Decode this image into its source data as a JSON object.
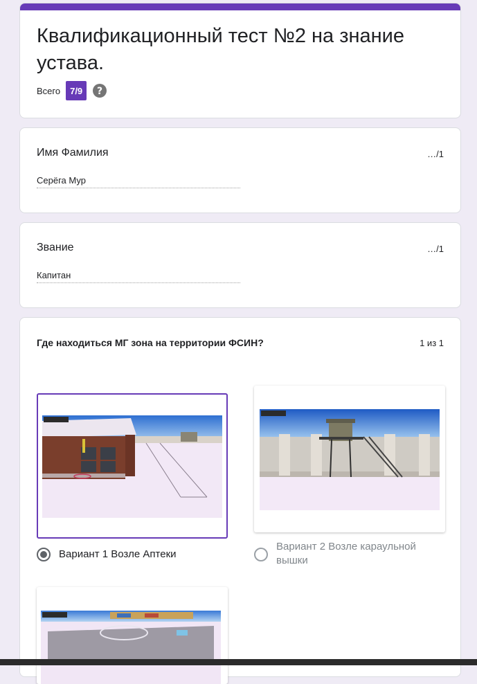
{
  "form": {
    "title": "Квалификационный тест №2 на знание устава.",
    "total_label": "Всего",
    "total_score": "7/9",
    "accent_color": "#673ab7"
  },
  "questions": [
    {
      "title": "Имя Фамилия",
      "score": "…/1",
      "answer": "Серёга Мур"
    },
    {
      "title": "Звание",
      "score": "…/1",
      "answer": "Капитан"
    }
  ],
  "image_question": {
    "title": "Где находиться МГ зона на территории ФСИН?",
    "score": "1 из 1",
    "options": [
      {
        "label": "Вариант 1 Возле Аптеки",
        "selected": true,
        "image": "building-near-pharmacy"
      },
      {
        "label": "Вариант 2 Возле караульной вышки",
        "selected": false,
        "image": "guard-tower-wall"
      },
      {
        "label": "",
        "selected": false,
        "image": "helipad-area"
      }
    ]
  },
  "icons": {
    "help": "help-circle-icon",
    "radio_on": "radio-checked-icon",
    "radio_off": "radio-unchecked-icon"
  }
}
